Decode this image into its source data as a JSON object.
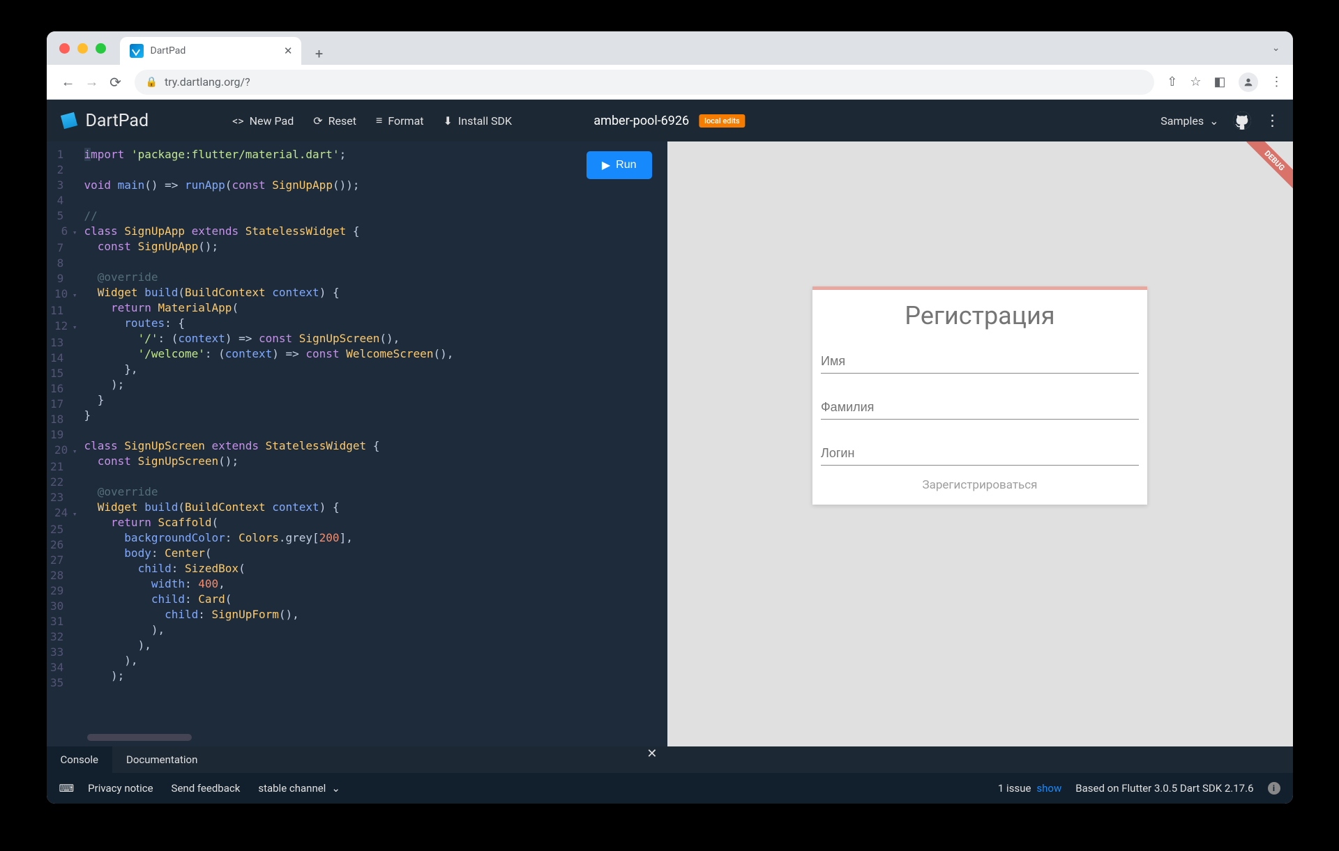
{
  "browser": {
    "tab_title": "DartPad",
    "url": "try.dartlang.org/?"
  },
  "topbar": {
    "app_name": "DartPad",
    "new_pad": "New Pad",
    "reset": "Reset",
    "format": "Format",
    "install_sdk": "Install SDK",
    "project_name": "amber-pool-6926",
    "local_edits_badge": "local edits",
    "samples": "Samples",
    "run_label": "Run"
  },
  "code": {
    "line_count": 35,
    "fold_lines": [
      6,
      10,
      12,
      20,
      24
    ],
    "lines": [
      {
        "n": 1,
        "html": "<span class='hl'><span class='kw'>i</span></span><span class='kw'>mport</span> <span class='str'>'package:flutter/material.dart'</span>;"
      },
      {
        "n": 2,
        "html": ""
      },
      {
        "n": 3,
        "html": "<span class='kw'>void</span> <span class='fn'>main</span>() =&gt; <span class='fn'>runApp</span>(<span class='kw'>const</span> <span class='cls'>SignUpApp</span>());"
      },
      {
        "n": 4,
        "html": ""
      },
      {
        "n": 5,
        "html": "<span class='com'>//</span>"
      },
      {
        "n": 6,
        "html": "<span class='kw'>class</span> <span class='cls'>SignUpApp</span> <span class='kw'>extends</span> <span class='cls'>StatelessWidget</span> {"
      },
      {
        "n": 7,
        "html": "  <span class='kw'>const</span> <span class='cls'>SignUpApp</span>();"
      },
      {
        "n": 8,
        "html": ""
      },
      {
        "n": 9,
        "html": "  <span class='com'>@override</span>"
      },
      {
        "n": 10,
        "html": "  <span class='cls'>Widget</span> <span class='fn'>build</span>(<span class='cls'>BuildContext</span> <span class='fn'>context</span>) {"
      },
      {
        "n": 11,
        "html": "    <span class='kw'>return</span> <span class='cls'>MaterialApp</span>("
      },
      {
        "n": 12,
        "html": "      <span class='fn'>routes</span>: {"
      },
      {
        "n": 13,
        "html": "        <span class='str'>'/'</span>: (<span class='fn'>context</span>) =&gt; <span class='kw'>const</span> <span class='cls'>SignUpScreen</span>(),"
      },
      {
        "n": 14,
        "html": "        <span class='str'>'/welcome'</span>: (<span class='fn'>context</span>) =&gt; <span class='kw'>const</span> <span class='cls'>WelcomeScreen</span>(),"
      },
      {
        "n": 15,
        "html": "      },"
      },
      {
        "n": 16,
        "html": "    );"
      },
      {
        "n": 17,
        "html": "  }"
      },
      {
        "n": 18,
        "html": "}"
      },
      {
        "n": 19,
        "html": ""
      },
      {
        "n": 20,
        "html": "<span class='kw'>class</span> <span class='cls'>SignUpScreen</span> <span class='kw'>extends</span> <span class='cls'>StatelessWidget</span> {"
      },
      {
        "n": 21,
        "html": "  <span class='kw'>const</span> <span class='cls'>SignUpScreen</span>();"
      },
      {
        "n": 22,
        "html": ""
      },
      {
        "n": 23,
        "html": "  <span class='com'>@override</span>"
      },
      {
        "n": 24,
        "html": "  <span class='cls'>Widget</span> <span class='fn'>build</span>(<span class='cls'>BuildContext</span> <span class='fn'>context</span>) {"
      },
      {
        "n": 25,
        "html": "    <span class='kw'>return</span> <span class='cls'>Scaffold</span>("
      },
      {
        "n": 26,
        "html": "      <span class='fn'>backgroundColor</span>: <span class='cls'>Colors</span>.grey[<span class='num'>200</span>],"
      },
      {
        "n": 27,
        "html": "      <span class='fn'>body</span>: <span class='cls'>Center</span>("
      },
      {
        "n": 28,
        "html": "        <span class='fn'>child</span>: <span class='cls'>SizedBox</span>("
      },
      {
        "n": 29,
        "html": "          <span class='fn'>width</span>: <span class='num'>400</span>,"
      },
      {
        "n": 30,
        "html": "          <span class='fn'>child</span>: <span class='cls'>Card</span>("
      },
      {
        "n": 31,
        "html": "            <span class='fn'>child</span>: <span class='cls'>SignUpForm</span>(),"
      },
      {
        "n": 32,
        "html": "          ),"
      },
      {
        "n": 33,
        "html": "        ),"
      },
      {
        "n": 34,
        "html": "      ),"
      },
      {
        "n": 35,
        "html": "    );"
      }
    ]
  },
  "preview": {
    "card_title": "Регистрация",
    "fields": {
      "first_name": "Имя",
      "last_name": "Фамилия",
      "login": "Логин"
    },
    "submit_label": "Зарегистрироваться"
  },
  "footer_tabs": {
    "console": "Console",
    "documentation": "Documentation"
  },
  "bottombar": {
    "privacy": "Privacy notice",
    "feedback": "Send feedback",
    "channel": "stable channel",
    "issues_text": "1 issue",
    "show": "show",
    "sdk_text": "Based on Flutter 3.0.5 Dart SDK 2.17.6"
  }
}
